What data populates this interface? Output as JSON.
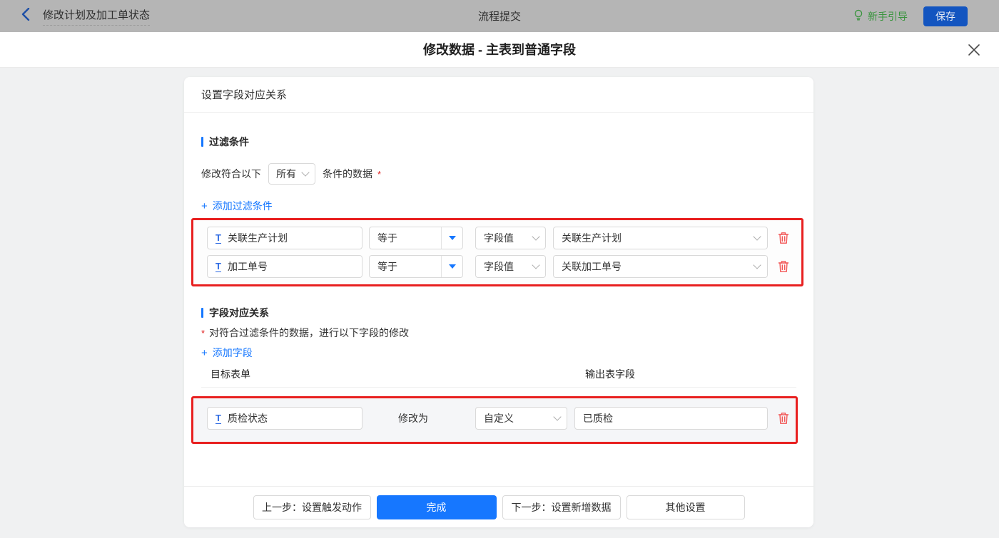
{
  "colors": {
    "accent": "#1677ff",
    "danger": "#f25555",
    "highlight_border": "#e82020",
    "guide_green": "#39943d",
    "topbar_bg": "#b5b5b5"
  },
  "icons": {
    "text_field": "T",
    "plus": "+"
  },
  "topbar": {
    "back_title": "修改计划及加工单状态",
    "center_title": "流程提交",
    "guide": "新手引导",
    "save": "保存"
  },
  "modal": {
    "title": "修改数据 - 主表到普通字段"
  },
  "panel": {
    "header": "设置字段对应关系",
    "filter": {
      "title": "过滤条件",
      "match_prefix": "修改符合以下",
      "match_value": "所有",
      "match_suffix": "条件的数据",
      "required_mark": "*",
      "add_label": "添加过滤条件",
      "rows": [
        {
          "field": "关联生产计划",
          "op": "等于",
          "value_type": "字段值",
          "value": "关联生产计划"
        },
        {
          "field": "加工单号",
          "op": "等于",
          "value_type": "字段值",
          "value": "关联加工单号"
        }
      ]
    },
    "mapping": {
      "title": "字段对应关系",
      "required_mark": "*",
      "desc": "对符合过滤条件的数据，进行以下字段的修改",
      "add_label": "添加字段",
      "col_left": "目标表单",
      "col_right": "输出表字段",
      "rows": [
        {
          "field": "质检状态",
          "action": "修改为",
          "mode": "自定义",
          "value": "已质检"
        }
      ]
    },
    "footer": {
      "prev": "上一步：设置触发动作",
      "done": "完成",
      "next": "下一步：设置新增数据",
      "other": "其他设置"
    }
  }
}
